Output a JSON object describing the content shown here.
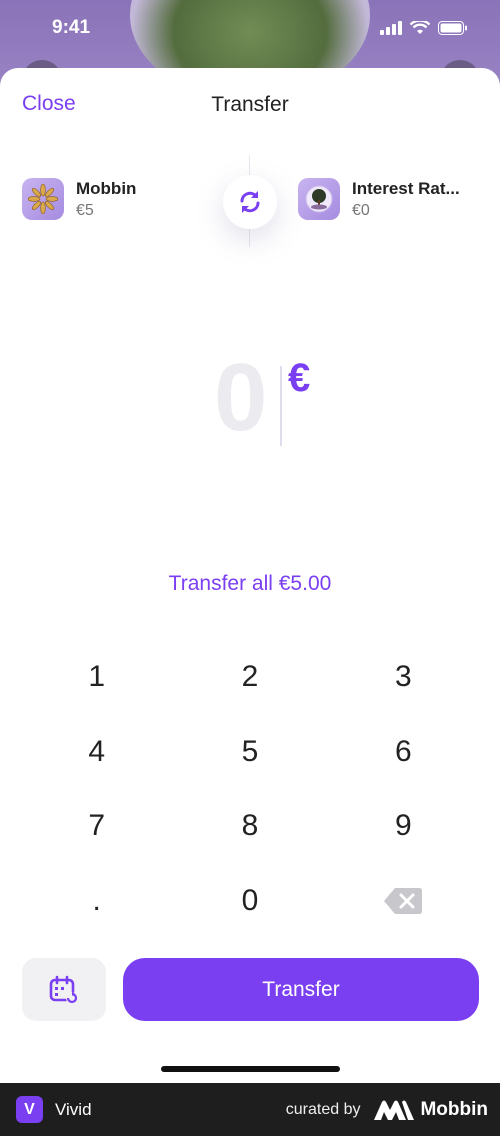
{
  "status": {
    "time": "9:41"
  },
  "nav": {
    "close_label": "Close",
    "title": "Transfer"
  },
  "from_account": {
    "name": "Mobbin",
    "balance": "€5",
    "icon": "sunburst-icon"
  },
  "to_account": {
    "name": "Interest Rat...",
    "balance": "€0",
    "icon": "tree-globe-icon"
  },
  "swap": {
    "icon": "swap-arrows-icon"
  },
  "amount": {
    "value": "0",
    "currency": "€"
  },
  "transfer_all_label": "Transfer all €5.00",
  "keypad": {
    "rows": [
      [
        "1",
        "2",
        "3"
      ],
      [
        "4",
        "5",
        "6"
      ],
      [
        "7",
        "8",
        "9"
      ],
      [
        ".",
        "0",
        ""
      ]
    ],
    "backspace_icon": "backspace-icon"
  },
  "actions": {
    "schedule_icon": "calendar-repeat-icon",
    "transfer_label": "Transfer"
  },
  "footer": {
    "app_letter": "V",
    "app_name": "Vivid",
    "curated_by": "curated by",
    "brand": "Mobbin"
  },
  "colors": {
    "accent": "#7b3ff2",
    "text": "#222222",
    "muted": "#777777"
  }
}
